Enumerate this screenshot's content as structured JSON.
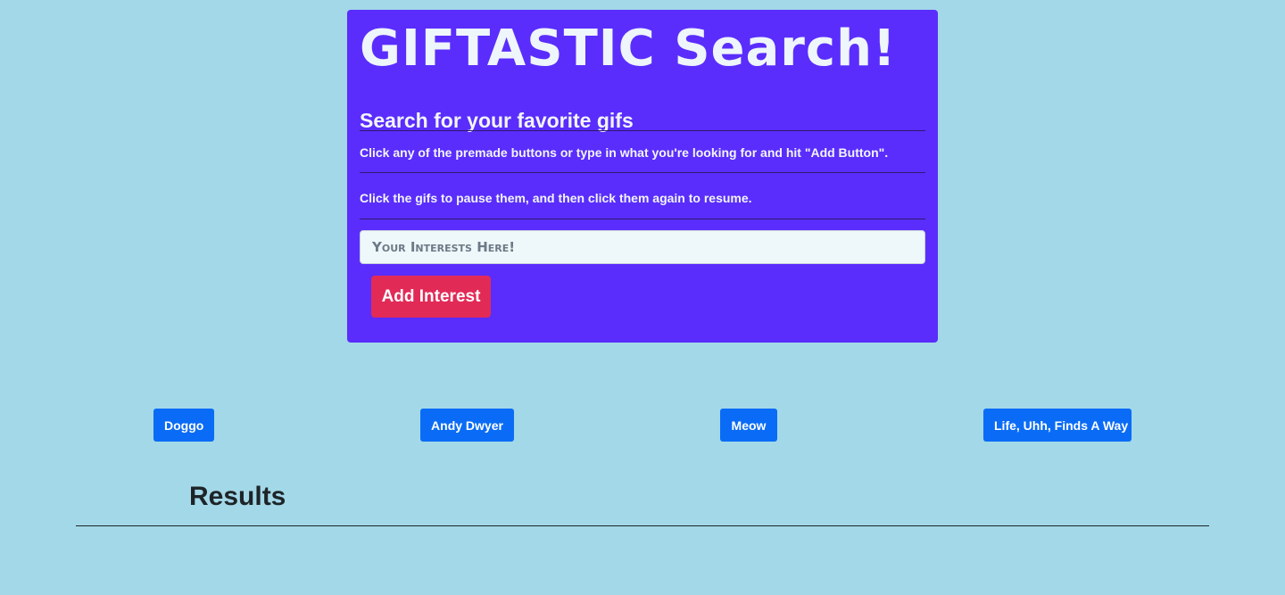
{
  "header": {
    "title": "GIFTASTIC Search!",
    "subtitle": "Search for your favorite gifs",
    "instruction_1": "Click any of the premade buttons or type in what you're looking for and hit \"Add Button\".",
    "instruction_2": "Click the gifs to pause them, and then click them again to resume."
  },
  "form": {
    "input_placeholder": "Your Interests Here!",
    "input_value": "",
    "add_button_label": "Add Interest"
  },
  "topics": [
    {
      "label": "Doggo"
    },
    {
      "label": "Andy Dwyer"
    },
    {
      "label": "Meow"
    },
    {
      "label": "Life, Uhh, Finds A Way"
    }
  ],
  "results": {
    "heading": "Results"
  },
  "colors": {
    "background": "#a3d8e8",
    "panel": "#5a2dfc",
    "add_button": "#e22a57",
    "topic_button": "#0a6cf6"
  }
}
